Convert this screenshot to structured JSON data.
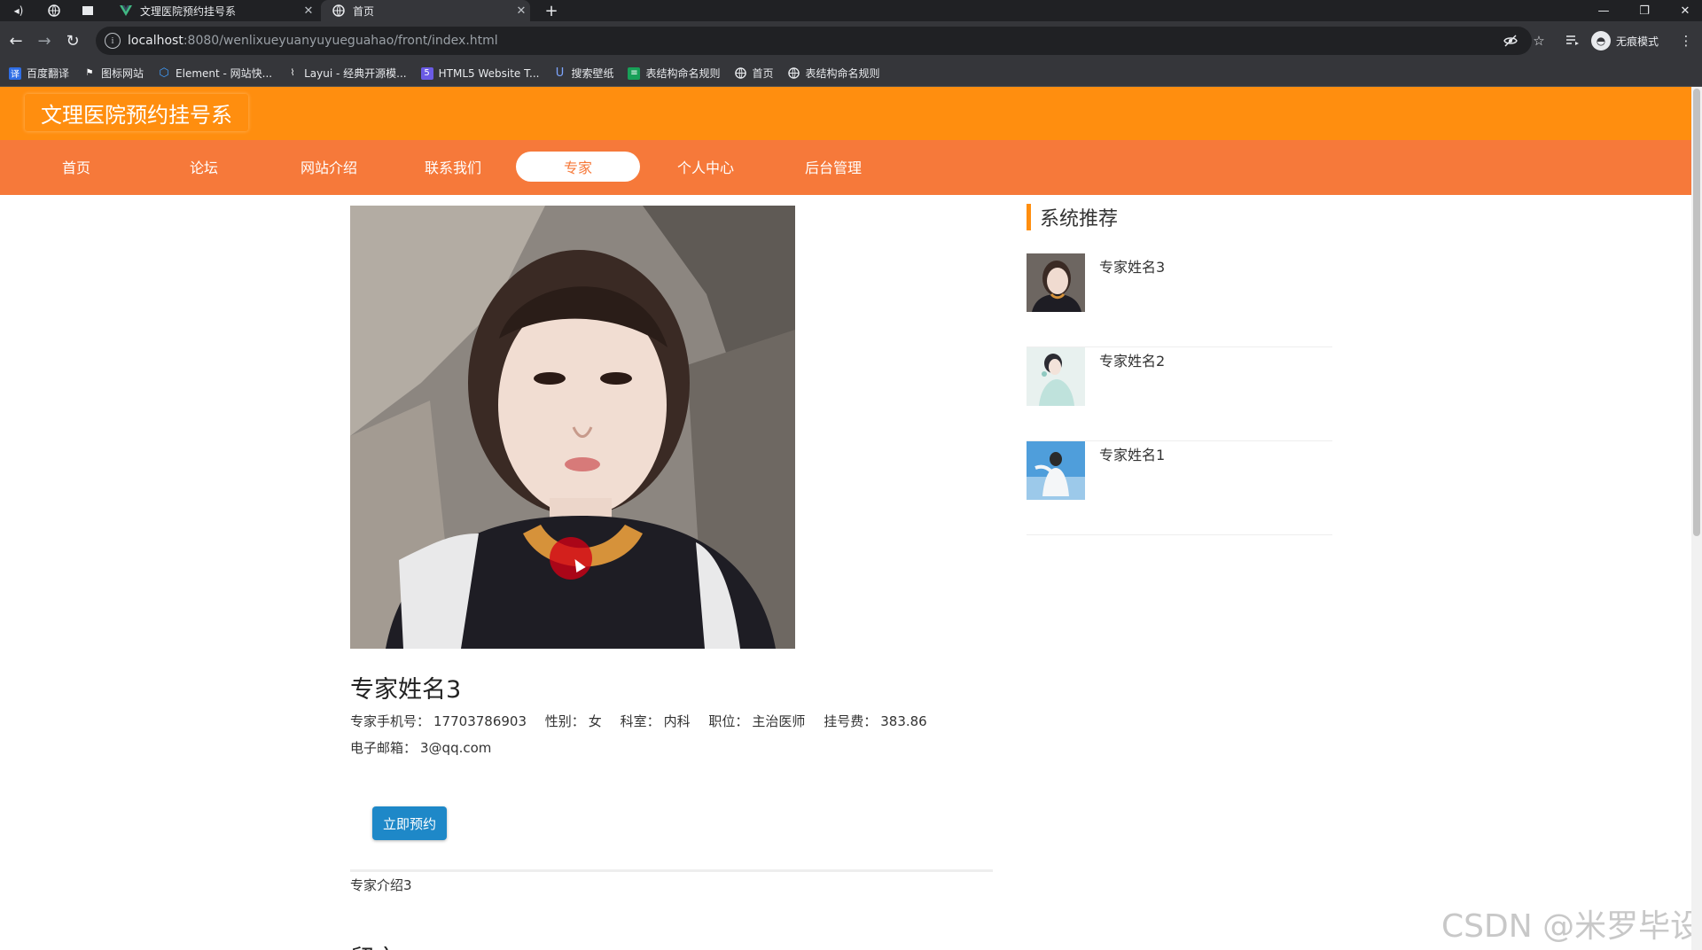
{
  "browser": {
    "tabs": [
      {
        "label": "文理医院预约挂号系",
        "icon": "vue-icon",
        "active": false
      },
      {
        "label": "首页",
        "icon": "globe-icon",
        "active": true
      }
    ],
    "address": {
      "host": "localhost",
      "path": ":8080/wenlixueyuanyuyueguahao/front/index.html"
    },
    "incognito_label": "无痕模式",
    "bookmarks": [
      {
        "label": "百度翻译",
        "icon": "translate-icon",
        "color": "#2f6ee6"
      },
      {
        "label": "图标网站",
        "icon": "flag-icon",
        "color": "#35363a"
      },
      {
        "label": "Element - 网站快...",
        "icon": "element-icon",
        "color": "#409eff"
      },
      {
        "label": "Layui - 经典开源模...",
        "icon": "layui-icon",
        "color": "#35363a"
      },
      {
        "label": "HTML5 Website T...",
        "icon": "html5-icon",
        "color": "#6b5be6"
      },
      {
        "label": "搜索壁纸",
        "icon": "wallpaper-icon",
        "color": "#4a7be6"
      },
      {
        "label": "表结构命名规则",
        "icon": "table-icon",
        "color": "#18a058"
      },
      {
        "label": "首页",
        "icon": "globe-icon",
        "color": "#35363a"
      },
      {
        "label": "表结构命名规则",
        "icon": "globe-icon",
        "color": "#35363a"
      }
    ]
  },
  "site": {
    "title": "文理医院预约挂号系",
    "nav": [
      {
        "label": "首页",
        "active": false
      },
      {
        "label": "论坛",
        "active": false
      },
      {
        "label": "网站介绍",
        "active": false
      },
      {
        "label": "联系我们",
        "active": false
      },
      {
        "label": "专家",
        "active": true
      },
      {
        "label": "个人中心",
        "active": false
      },
      {
        "label": "后台管理",
        "active": false
      }
    ],
    "colors": {
      "header": "#ff8e0f",
      "nav": "#f6793a",
      "button": "#1e88c8"
    }
  },
  "expert": {
    "name": "专家姓名3",
    "phone_label": "专家手机号：",
    "phone": "17703786903",
    "gender_label": "性别：",
    "gender": "女",
    "dept_label": "科室：",
    "dept": "内科",
    "position_label": "职位：",
    "position": "主治医师",
    "fee_label": "挂号费：",
    "fee": "383.86",
    "email_label": "电子邮箱：",
    "email": "3@qq.com",
    "book_button": "立即预约",
    "intro": "专家介绍3",
    "comments_title": "留言"
  },
  "recommend": {
    "title": "系统推荐",
    "items": [
      {
        "name": "专家姓名3"
      },
      {
        "name": "专家姓名2"
      },
      {
        "name": "专家姓名1"
      }
    ]
  },
  "watermark": "CSDN @米罗毕设"
}
